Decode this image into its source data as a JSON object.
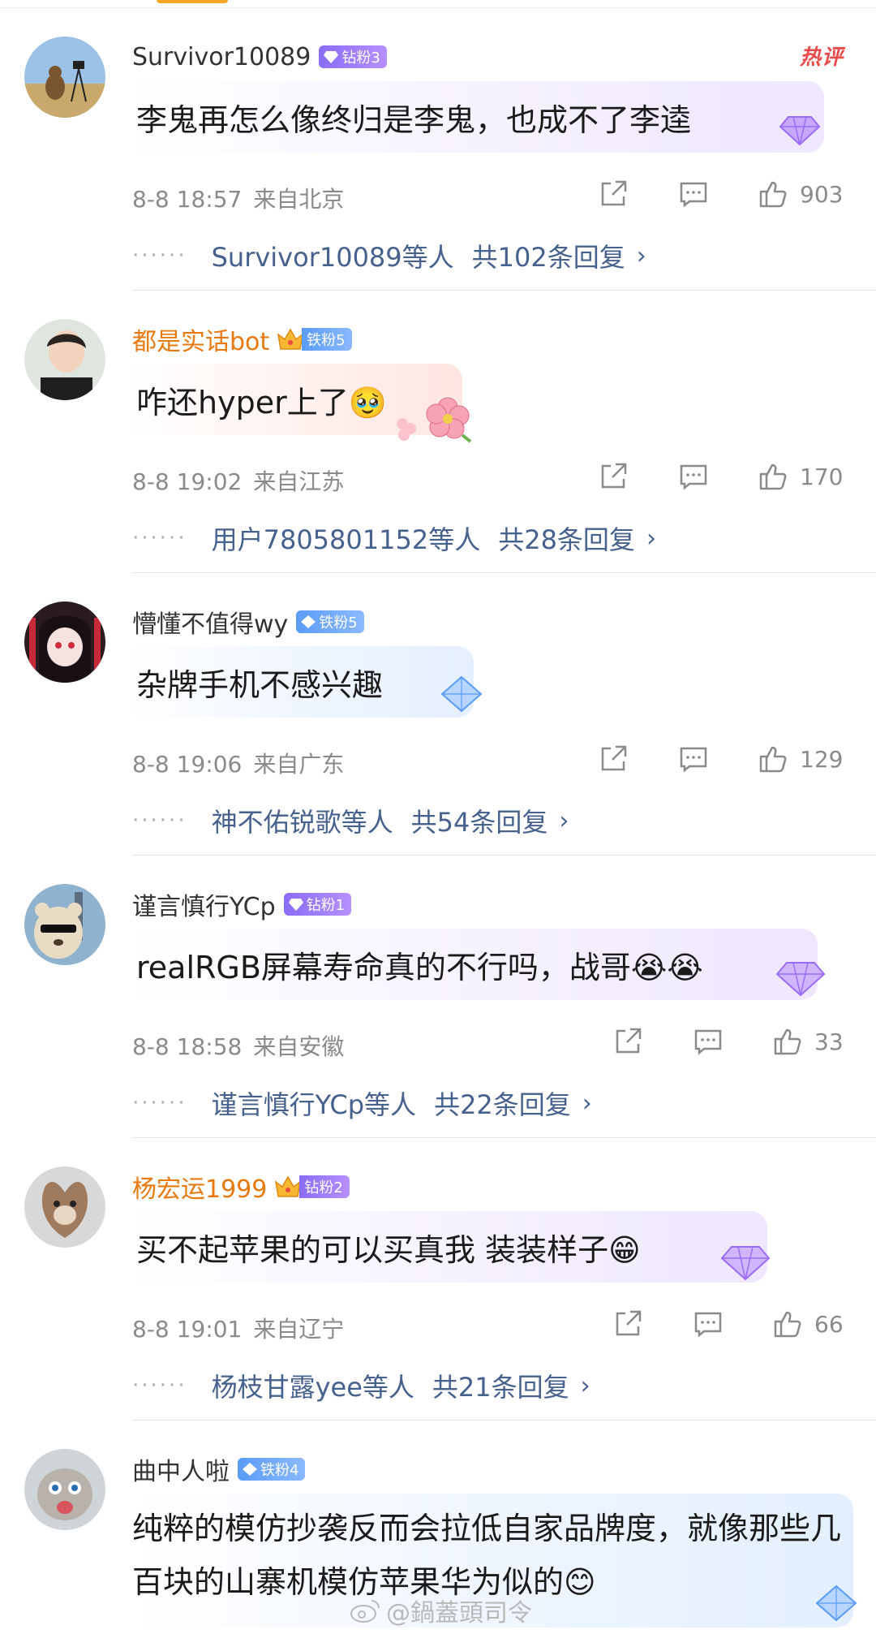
{
  "comments": [
    {
      "username": "Survivor10089",
      "badge": "钻粉3",
      "hot_tag": "热评",
      "text": "李鬼再怎么像终归是李鬼，也成不了李逵",
      "time": "8-8 18:57",
      "location": "来自北京",
      "likes": "903",
      "reply_users": "Survivor10089等人",
      "reply_total": "共102条回复"
    },
    {
      "username": "都是实话bot",
      "badge": "铁粉5",
      "text": "咋还hyper上了🥹",
      "time": "8-8 19:02",
      "location": "来自江苏",
      "likes": "170",
      "reply_users": "用户7805801152等人",
      "reply_total": "共28条回复"
    },
    {
      "username": "懵懂不值得wy",
      "badge": "铁粉5",
      "text": "杂牌手机不感兴趣",
      "time": "8-8 19:06",
      "location": "来自广东",
      "likes": "129",
      "reply_users": "神不佑锐歌等人",
      "reply_total": "共54条回复"
    },
    {
      "username": "谨言慎行YCp",
      "badge": "钻粉1",
      "text": "realRGB屏幕寿命真的不行吗，战哥😭😭",
      "time": "8-8 18:58",
      "location": "来自安徽",
      "likes": "33",
      "reply_users": "谨言慎行YCp等人",
      "reply_total": "共22条回复"
    },
    {
      "username": "杨宏运1999",
      "badge": "钻粉2",
      "text": "买不起苹果的可以买真我 装装样子😁",
      "time": "8-8 19:01",
      "location": "来自辽宁",
      "likes": "66",
      "reply_users": "杨枝甘露yee等人",
      "reply_total": "共21条回复"
    },
    {
      "username": "曲中人啦",
      "badge": "铁粉4",
      "text": "纯粹的模仿抄袭反而会拉低自家品牌度，就像那些几百块的山寨机模仿苹果华为似的😊"
    }
  ],
  "watermark": "@鍋蓋頭司令",
  "colors": {
    "link": "#46618e",
    "diamond_badge": "#8a6cf7",
    "iron_badge": "#5a9cf8",
    "crown_name": "#e8790f",
    "hot": "#e94b4b"
  }
}
